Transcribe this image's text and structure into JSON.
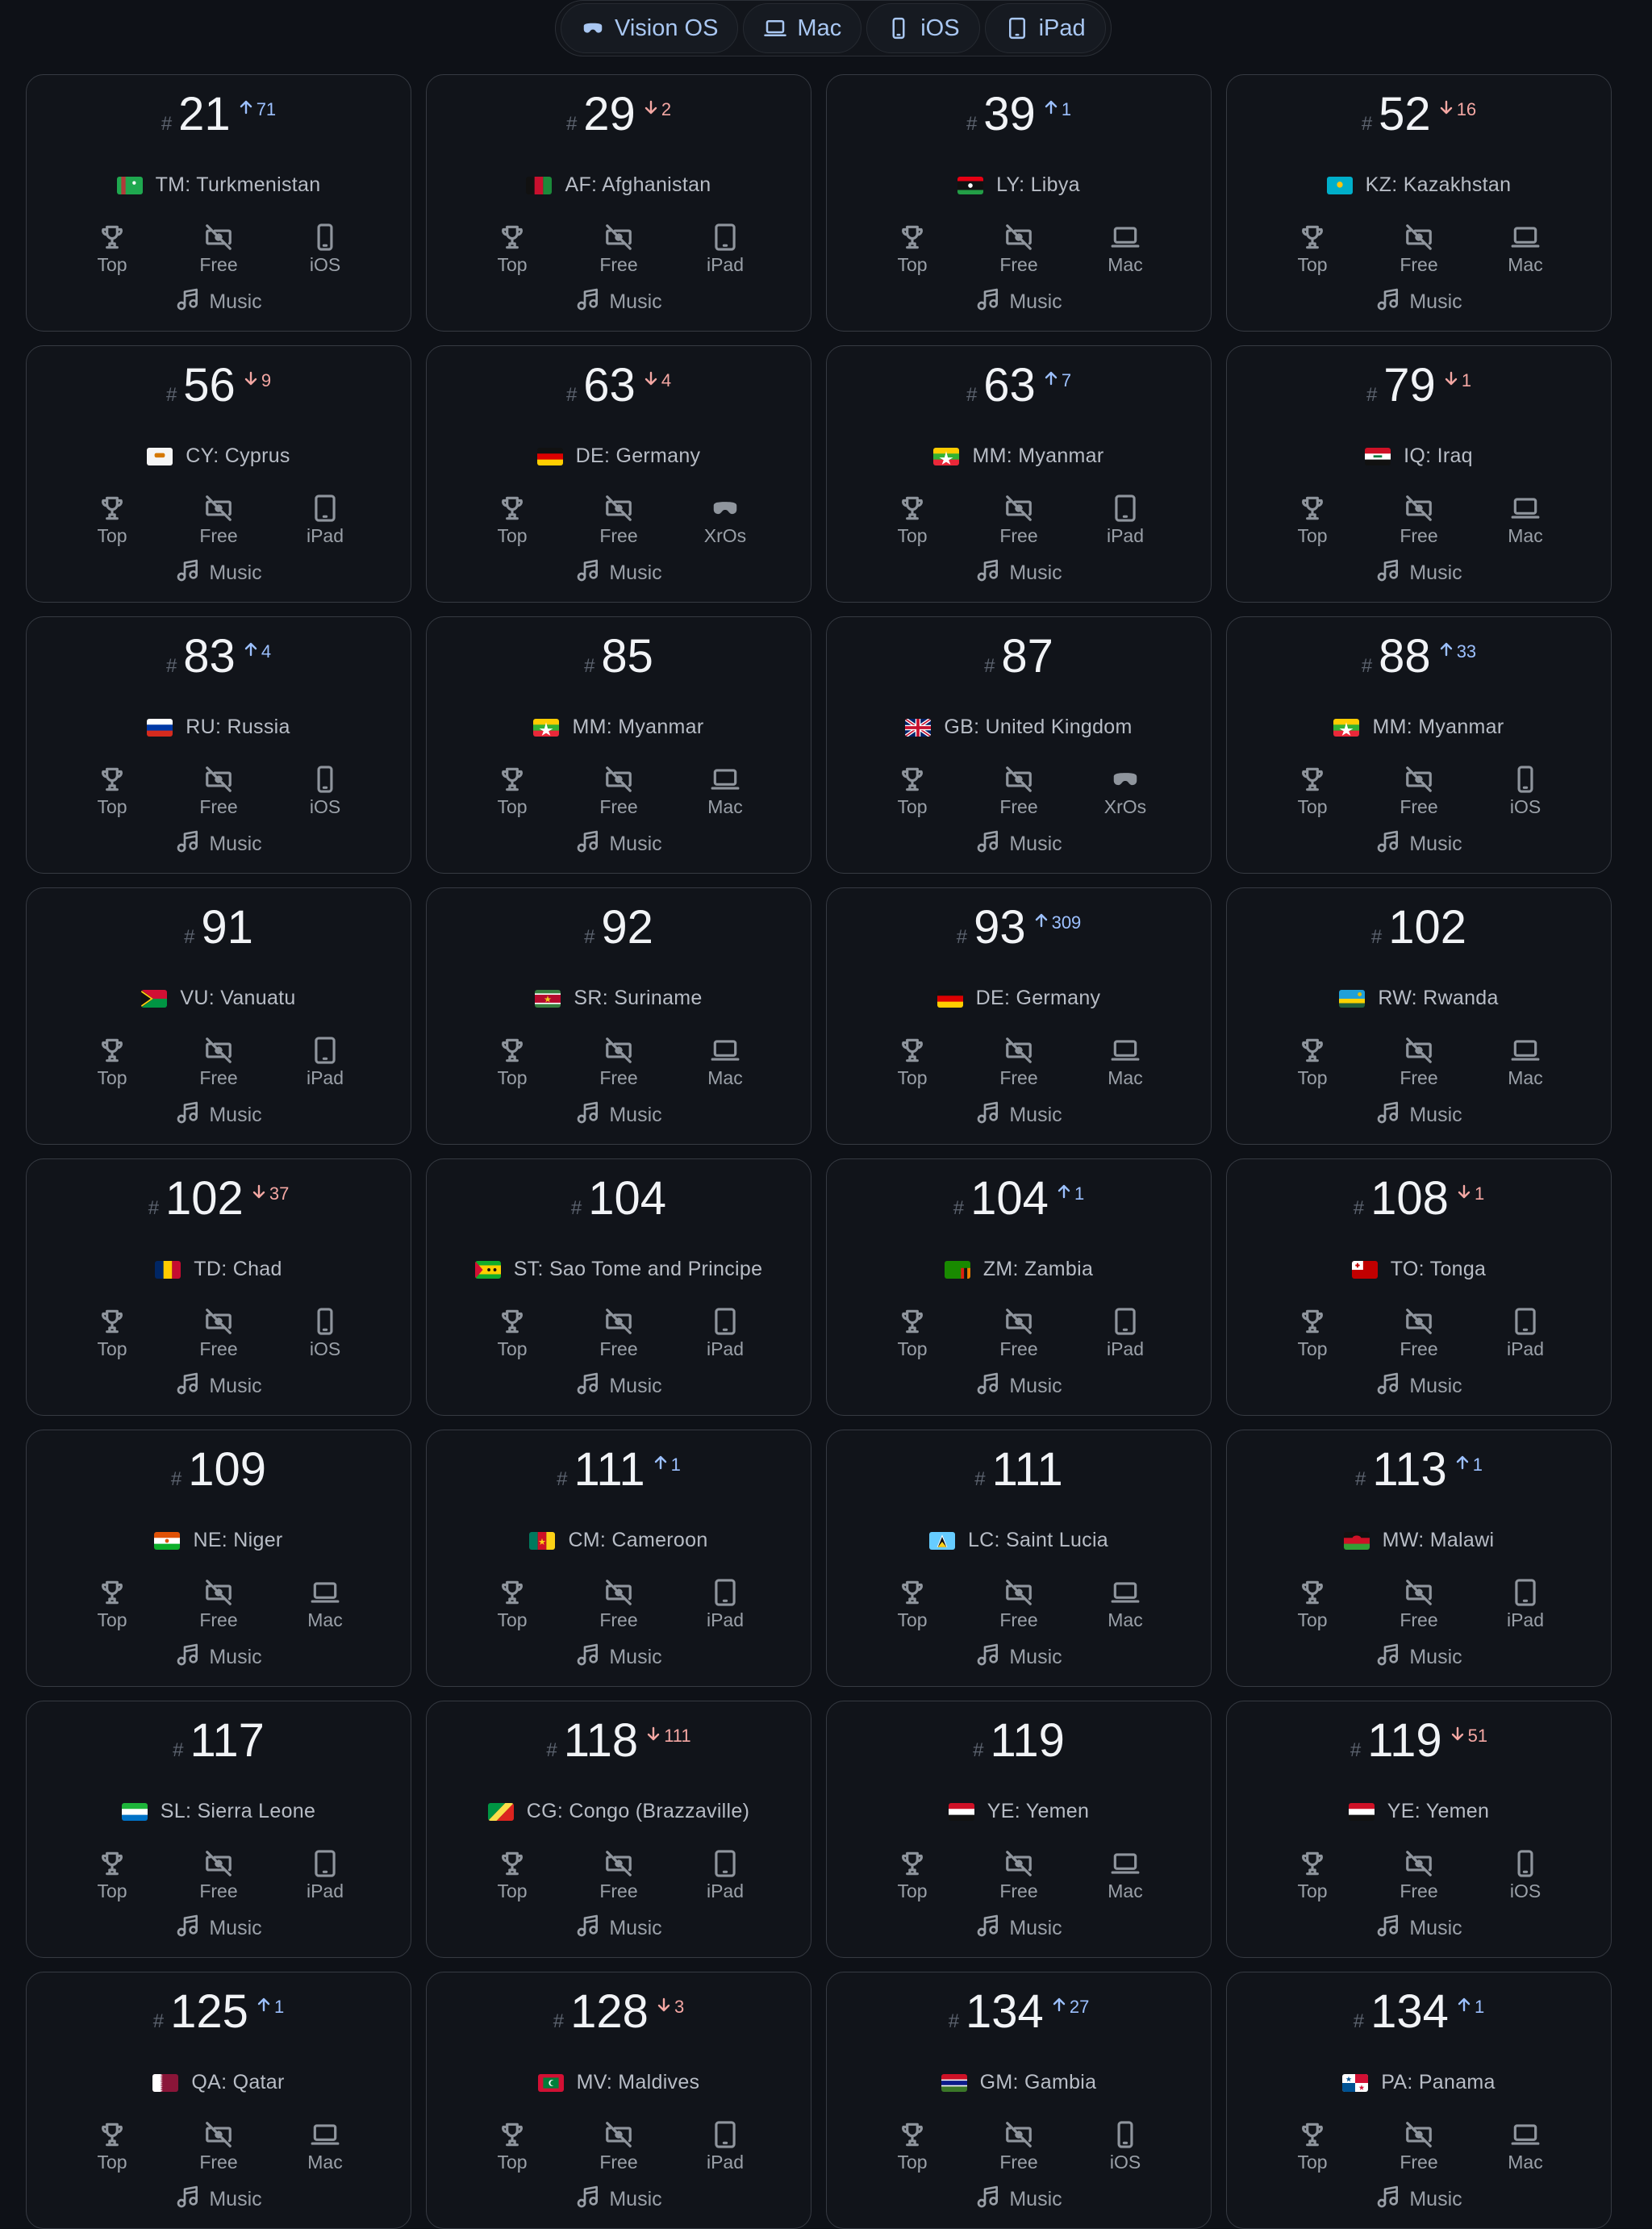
{
  "platforms": [
    {
      "label": "Vision OS",
      "icon": "vision-icon"
    },
    {
      "label": "Mac",
      "icon": "laptop-icon"
    },
    {
      "label": "iOS",
      "icon": "phone-icon"
    },
    {
      "label": "iPad",
      "icon": "tablet-icon"
    }
  ],
  "labels": {
    "hash": "#",
    "top": "Top",
    "free": "Free",
    "genre": "Music"
  },
  "colors": {
    "up": "#9cc0ff",
    "down": "#f4a7a3",
    "accent": "#a9c7f2"
  },
  "cards": [
    {
      "rank": "21",
      "change": "71",
      "dir": "up",
      "country": "TM: Turkmenistan",
      "flag": "TM",
      "device": "iOS"
    },
    {
      "rank": "29",
      "change": "2",
      "dir": "down",
      "country": "AF: Afghanistan",
      "flag": "AF",
      "device": "iPad"
    },
    {
      "rank": "39",
      "change": "1",
      "dir": "up",
      "country": "LY: Libya",
      "flag": "LY",
      "device": "Mac"
    },
    {
      "rank": "52",
      "change": "16",
      "dir": "down",
      "country": "KZ: Kazakhstan",
      "flag": "KZ",
      "device": "Mac"
    },
    {
      "rank": "56",
      "change": "9",
      "dir": "down",
      "country": "CY: Cyprus",
      "flag": "CY",
      "device": "iPad"
    },
    {
      "rank": "63",
      "change": "4",
      "dir": "down",
      "country": "DE: Germany",
      "flag": "DE",
      "device": "XrOs"
    },
    {
      "rank": "63",
      "change": "7",
      "dir": "up",
      "country": "MM: Myanmar",
      "flag": "MM",
      "device": "iPad"
    },
    {
      "rank": "79",
      "change": "1",
      "dir": "down",
      "country": "IQ: Iraq",
      "flag": "IQ",
      "device": "Mac"
    },
    {
      "rank": "83",
      "change": "4",
      "dir": "up",
      "country": "RU: Russia",
      "flag": "RU",
      "device": "iOS"
    },
    {
      "rank": "85",
      "change": "",
      "dir": "",
      "country": "MM: Myanmar",
      "flag": "MM",
      "device": "Mac"
    },
    {
      "rank": "87",
      "change": "",
      "dir": "",
      "country": "GB: United Kingdom",
      "flag": "GB",
      "device": "XrOs"
    },
    {
      "rank": "88",
      "change": "33",
      "dir": "up",
      "country": "MM: Myanmar",
      "flag": "MM",
      "device": "iOS"
    },
    {
      "rank": "91",
      "change": "",
      "dir": "",
      "country": "VU: Vanuatu",
      "flag": "VU",
      "device": "iPad"
    },
    {
      "rank": "92",
      "change": "",
      "dir": "",
      "country": "SR: Suriname",
      "flag": "SR",
      "device": "Mac"
    },
    {
      "rank": "93",
      "change": "309",
      "dir": "up",
      "country": "DE: Germany",
      "flag": "DE",
      "device": "Mac"
    },
    {
      "rank": "102",
      "change": "",
      "dir": "",
      "country": "RW: Rwanda",
      "flag": "RW",
      "device": "Mac"
    },
    {
      "rank": "102",
      "change": "37",
      "dir": "down",
      "country": "TD: Chad",
      "flag": "TD",
      "device": "iOS"
    },
    {
      "rank": "104",
      "change": "",
      "dir": "",
      "country": "ST: Sao Tome and Principe",
      "flag": "ST",
      "device": "iPad"
    },
    {
      "rank": "104",
      "change": "1",
      "dir": "up",
      "country": "ZM: Zambia",
      "flag": "ZM",
      "device": "iPad"
    },
    {
      "rank": "108",
      "change": "1",
      "dir": "down",
      "country": "TO: Tonga",
      "flag": "TO",
      "device": "iPad"
    },
    {
      "rank": "109",
      "change": "",
      "dir": "",
      "country": "NE: Niger",
      "flag": "NE",
      "device": "Mac"
    },
    {
      "rank": "111",
      "change": "1",
      "dir": "up",
      "country": "CM: Cameroon",
      "flag": "CM",
      "device": "iPad"
    },
    {
      "rank": "111",
      "change": "",
      "dir": "",
      "country": "LC: Saint Lucia",
      "flag": "LC",
      "device": "Mac"
    },
    {
      "rank": "113",
      "change": "1",
      "dir": "up",
      "country": "MW: Malawi",
      "flag": "MW",
      "device": "iPad"
    },
    {
      "rank": "117",
      "change": "",
      "dir": "",
      "country": "SL: Sierra Leone",
      "flag": "SL",
      "device": "iPad"
    },
    {
      "rank": "118",
      "change": "111",
      "dir": "down",
      "country": "CG: Congo (Brazzaville)",
      "flag": "CG",
      "device": "iPad"
    },
    {
      "rank": "119",
      "change": "",
      "dir": "",
      "country": "YE: Yemen",
      "flag": "YE",
      "device": "Mac"
    },
    {
      "rank": "119",
      "change": "51",
      "dir": "down",
      "country": "YE: Yemen",
      "flag": "YE",
      "device": "iOS"
    },
    {
      "rank": "125",
      "change": "1",
      "dir": "up",
      "country": "QA: Qatar",
      "flag": "QA",
      "device": "Mac"
    },
    {
      "rank": "128",
      "change": "3",
      "dir": "down",
      "country": "MV: Maldives",
      "flag": "MV",
      "device": "iPad"
    },
    {
      "rank": "134",
      "change": "27",
      "dir": "up",
      "country": "GM: Gambia",
      "flag": "GM",
      "device": "iOS"
    },
    {
      "rank": "134",
      "change": "1",
      "dir": "up",
      "country": "PA: Panama",
      "flag": "PA",
      "device": "Mac"
    }
  ]
}
